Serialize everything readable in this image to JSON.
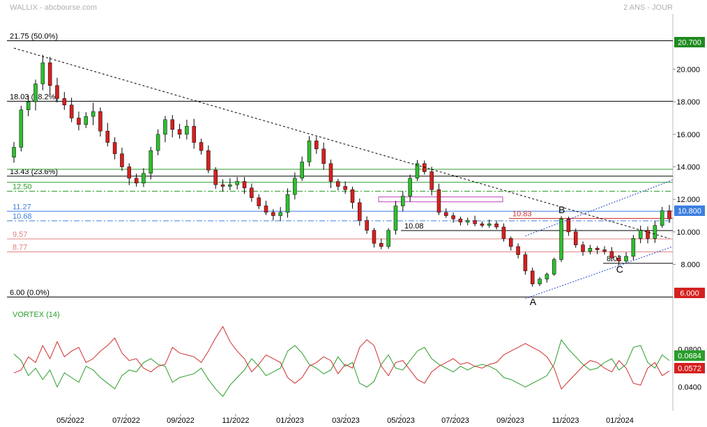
{
  "header": {
    "title": "WALLIX - abcbourse.com",
    "period": "2 ANS - JOUR"
  },
  "chart_data": [
    {
      "type": "candlestick",
      "name": "price",
      "ylim": [
        5.5,
        23.4
      ],
      "x_ticks": [
        "05/2022",
        "07/2022",
        "09/2022",
        "11/2022",
        "01/2023",
        "03/2023",
        "05/2023",
        "07/2023",
        "09/2023",
        "11/2023",
        "01/2024"
      ],
      "y_ticks": [
        "20.000",
        "18.000",
        "16.000",
        "14.000",
        "12.000",
        "10.000",
        "8.000"
      ],
      "last_price": "20.700",
      "current_price": "10.800",
      "low_marker": "6.000",
      "fibonacci_levels": [
        {
          "label": "21.75  (50.0%)",
          "value": 21.75
        },
        {
          "label": "18.03  (38.2%)",
          "value": 18.03
        },
        {
          "label": "13.43  (23.6%)",
          "value": 13.43
        },
        {
          "label": "6.00  (0.0%)",
          "value": 6.0
        }
      ],
      "levels": [
        {
          "label": "12.50",
          "value": 12.5,
          "color": "#2a9d2a",
          "style": "dashdot"
        },
        {
          "label": "11.27",
          "value": 11.27,
          "color": "#3d7fe0",
          "style": "solid"
        },
        {
          "label": "10.68",
          "value": 10.68,
          "color": "#3d7fe0",
          "style": "dashdot"
        },
        {
          "label": "9.57",
          "value": 9.57,
          "color": "#e08080",
          "style": "solid"
        },
        {
          "label": "8.77",
          "value": 8.77,
          "color": "#e08080",
          "style": "solid"
        },
        {
          "label": "10.83",
          "value": 10.83,
          "color": "#d03030",
          "style": "solid"
        }
      ],
      "support_labels": [
        {
          "label": "10.08",
          "value": 10.08
        },
        {
          "label": "8.07",
          "value": 8.07
        }
      ],
      "wave_labels": [
        "A",
        "B",
        "C"
      ],
      "series": [
        {
          "name": "close",
          "values": [
            15.2,
            17.5,
            18.0,
            19.1,
            20.4,
            19.0,
            18.2,
            17.8,
            17.0,
            16.6,
            17.1,
            17.4,
            16.2,
            15.5,
            14.8,
            14.0,
            13.3,
            13.0,
            13.6,
            15.0,
            16.0,
            16.9,
            16.3,
            16.0,
            16.5,
            15.5,
            15.0,
            13.8,
            12.9,
            12.8,
            12.9,
            13.1,
            12.7,
            12.1,
            11.6,
            11.2,
            11.0,
            11.2,
            12.3,
            13.3,
            14.3,
            15.6,
            15.1,
            14.2,
            13.1,
            12.8,
            12.6,
            11.8,
            10.7,
            10.1,
            9.3,
            9.1,
            10.1,
            11.6,
            12.2,
            13.3,
            14.2,
            13.7,
            12.6,
            11.2,
            11.0,
            10.8,
            10.6,
            10.7,
            10.5,
            10.4,
            10.5,
            10.3,
            9.6,
            9.1,
            8.6,
            7.6,
            6.8,
            7.1,
            7.4,
            8.3,
            10.8,
            10.0,
            9.2,
            8.8,
            9.0,
            8.9,
            8.8,
            8.4,
            8.2,
            8.5,
            9.6,
            10.1,
            9.6,
            10.4,
            11.3,
            10.8
          ]
        }
      ],
      "wave_points": [
        {
          "label": "A",
          "x": 72,
          "value": 6.1
        },
        {
          "label": "B",
          "x": 76,
          "value": 10.8
        },
        {
          "label": "C",
          "x": 84,
          "value": 8.1
        }
      ],
      "trendline_down": [
        {
          "x": 0,
          "value": 21.3
        },
        {
          "x": 91,
          "value": 9.6
        }
      ],
      "channel_lower": [
        {
          "x": 71,
          "value": 5.9
        },
        {
          "x": 91,
          "value": 9.1
        }
      ],
      "channel_upper": [
        {
          "x": 71,
          "value": 9.75
        },
        {
          "x": 91,
          "value": 13.2
        }
      ]
    },
    {
      "type": "line",
      "name": "vortex",
      "title": "VORTEX (14)",
      "ylim": [
        0.022,
        0.112
      ],
      "y_ticks": [
        "0.0800",
        "0.0400"
      ],
      "latest": {
        "plus": "0.0684",
        "minus": "0.0572"
      },
      "series": [
        {
          "name": "plus",
          "color": "#2a9d2a",
          "values": [
            0.075,
            0.068,
            0.052,
            0.06,
            0.048,
            0.058,
            0.04,
            0.055,
            0.05,
            0.045,
            0.062,
            0.058,
            0.05,
            0.044,
            0.038,
            0.052,
            0.058,
            0.056,
            0.066,
            0.07,
            0.064,
            0.062,
            0.045,
            0.05,
            0.052,
            0.054,
            0.06,
            0.048,
            0.038,
            0.03,
            0.042,
            0.05,
            0.058,
            0.07,
            0.062,
            0.052,
            0.056,
            0.06,
            0.078,
            0.084,
            0.076,
            0.064,
            0.06,
            0.054,
            0.058,
            0.072,
            0.062,
            0.066,
            0.044,
            0.04,
            0.046,
            0.064,
            0.074,
            0.06,
            0.058,
            0.068,
            0.078,
            0.082,
            0.07,
            0.064,
            0.06,
            0.056,
            0.062,
            0.058,
            0.062,
            0.064,
            0.062,
            0.058,
            0.05,
            0.048,
            0.044,
            0.04,
            0.044,
            0.048,
            0.052,
            0.064,
            0.09,
            0.08,
            0.072,
            0.064,
            0.058,
            0.06,
            0.066,
            0.07,
            0.058,
            0.064,
            0.082,
            0.084,
            0.066,
            0.06,
            0.074,
            0.068
          ]
        },
        {
          "name": "minus",
          "color": "#d03030",
          "values": [
            0.055,
            0.058,
            0.072,
            0.066,
            0.084,
            0.07,
            0.088,
            0.072,
            0.078,
            0.082,
            0.066,
            0.07,
            0.078,
            0.084,
            0.092,
            0.076,
            0.068,
            0.07,
            0.06,
            0.056,
            0.062,
            0.064,
            0.082,
            0.076,
            0.074,
            0.072,
            0.066,
            0.078,
            0.092,
            0.104,
            0.088,
            0.078,
            0.07,
            0.056,
            0.064,
            0.074,
            0.07,
            0.066,
            0.05,
            0.044,
            0.05,
            0.062,
            0.066,
            0.072,
            0.068,
            0.054,
            0.064,
            0.06,
            0.082,
            0.09,
            0.084,
            0.062,
            0.052,
            0.066,
            0.068,
            0.058,
            0.048,
            0.044,
            0.056,
            0.062,
            0.066,
            0.07,
            0.064,
            0.066,
            0.062,
            0.06,
            0.064,
            0.066,
            0.074,
            0.078,
            0.082,
            0.086,
            0.082,
            0.078,
            0.072,
            0.06,
            0.038,
            0.046,
            0.054,
            0.062,
            0.068,
            0.066,
            0.06,
            0.056,
            0.068,
            0.06,
            0.044,
            0.042,
            0.06,
            0.066,
            0.052,
            0.057
          ]
        }
      ]
    }
  ],
  "colors": {
    "up": "#2fbf2f",
    "down": "#d52020",
    "plus_label_bg": "#2a9d2a",
    "minus_label_bg": "#d52020",
    "current_label_bg": "#3d7fe0",
    "accent_box": "#c040c0"
  }
}
